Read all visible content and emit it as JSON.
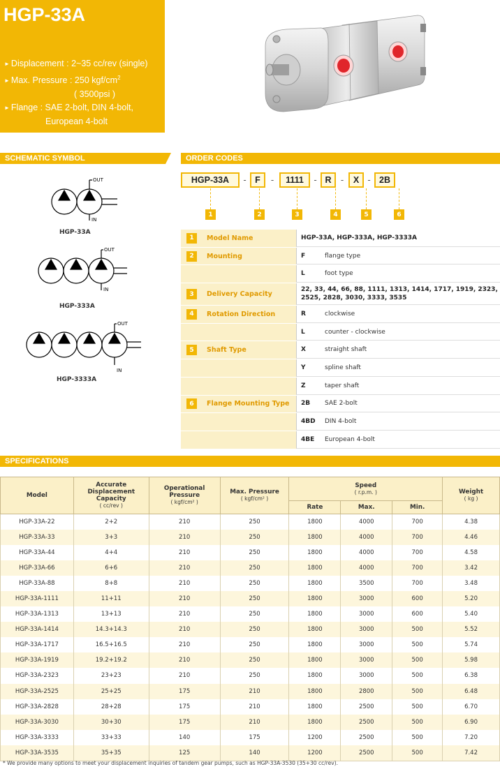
{
  "header": {
    "title": "HGP-33A",
    "features": [
      {
        "text": "Displacement : 2~35 cc/rev (single)"
      },
      {
        "text": "Max. Pressure : 250 kgf/cm",
        "sup": "2",
        "cont": "( 3500psi )"
      },
      {
        "text": "Flange : SAE 2-bolt, DIN 4-bolt,",
        "cont": "European 4-bolt"
      }
    ]
  },
  "schematic": {
    "title": "SCHEMATIC SYMBOL",
    "out_label": "OUT",
    "in_label": "IN",
    "symbols": [
      {
        "label": "HGP-33A"
      },
      {
        "label": "HGP-333A"
      },
      {
        "label": "HGP-3333A"
      }
    ]
  },
  "order_codes": {
    "title": "ORDER CODES",
    "codes": [
      "HGP-33A",
      "F",
      "1111",
      "R",
      "X",
      "2B"
    ],
    "dash": "-",
    "numbers": [
      "1",
      "2",
      "3",
      "4",
      "5",
      "6"
    ],
    "rows": [
      {
        "num": "1",
        "name": "Model Name",
        "full": "HGP-33A, HGP-333A, HGP-3333A"
      },
      {
        "num": "2",
        "name": "Mounting",
        "code": "F",
        "desc": "flange type"
      },
      {
        "num": "",
        "name": "",
        "code": "L",
        "desc": "foot type"
      },
      {
        "num": "3",
        "name": "Delivery Capacity",
        "full": "22, 33, 44, 66, 88, 1111, 1313, 1414, 1717, 1919, 2323, 2525, 2828, 3030, 3333, 3535"
      },
      {
        "num": "4",
        "name": "Rotation Direction",
        "code": "R",
        "desc": "clockwise"
      },
      {
        "num": "",
        "name": "",
        "code": "L",
        "desc": "counter - clockwise"
      },
      {
        "num": "5",
        "name": "Shaft Type",
        "code": "X",
        "desc": "straight shaft"
      },
      {
        "num": "",
        "name": "",
        "code": "Y",
        "desc": "spline shaft"
      },
      {
        "num": "",
        "name": "",
        "code": "Z",
        "desc": "taper shaft"
      },
      {
        "num": "6",
        "name": "Flange Mounting Type",
        "code": "2B",
        "desc": "SAE 2-bolt"
      },
      {
        "num": "",
        "name": "",
        "code": "4BD",
        "desc": "DIN 4-bolt"
      },
      {
        "num": "",
        "name": "",
        "code": "4BE",
        "desc": "European 4-bolt"
      }
    ]
  },
  "specifications": {
    "title": "SPECIFICATIONS",
    "headers": {
      "model": "Model",
      "disp": "Accurate Displacement Capacity",
      "disp_unit": "( cc/rev )",
      "op": "Operational Pressure",
      "op_unit": "( kgf/cm² )",
      "max": "Max. Pressure",
      "max_unit": "( kgf/cm² )",
      "speed": "Speed",
      "speed_unit": "( r.p.m. )",
      "rate": "Rate",
      "smax": "Max.",
      "smin": "Min.",
      "weight": "Weight",
      "weight_unit": "( kg )"
    },
    "rows": [
      [
        "HGP-33A-22",
        "2+2",
        "210",
        "250",
        "1800",
        "4000",
        "700",
        "4.38"
      ],
      [
        "HGP-33A-33",
        "3+3",
        "210",
        "250",
        "1800",
        "4000",
        "700",
        "4.46"
      ],
      [
        "HGP-33A-44",
        "4+4",
        "210",
        "250",
        "1800",
        "4000",
        "700",
        "4.58"
      ],
      [
        "HGP-33A-66",
        "6+6",
        "210",
        "250",
        "1800",
        "4000",
        "700",
        "3.42"
      ],
      [
        "HGP-33A-88",
        "8+8",
        "210",
        "250",
        "1800",
        "3500",
        "700",
        "3.48"
      ],
      [
        "HGP-33A-1111",
        "11+11",
        "210",
        "250",
        "1800",
        "3000",
        "600",
        "5.20"
      ],
      [
        "HGP-33A-1313",
        "13+13",
        "210",
        "250",
        "1800",
        "3000",
        "600",
        "5.40"
      ],
      [
        "HGP-33A-1414",
        "14.3+14.3",
        "210",
        "250",
        "1800",
        "3000",
        "500",
        "5.52"
      ],
      [
        "HGP-33A-1717",
        "16.5+16.5",
        "210",
        "250",
        "1800",
        "3000",
        "500",
        "5.74"
      ],
      [
        "HGP-33A-1919",
        "19.2+19.2",
        "210",
        "250",
        "1800",
        "3000",
        "500",
        "5.98"
      ],
      [
        "HGP-33A-2323",
        "23+23",
        "210",
        "250",
        "1800",
        "3000",
        "500",
        "6.38"
      ],
      [
        "HGP-33A-2525",
        "25+25",
        "175",
        "210",
        "1800",
        "2800",
        "500",
        "6.48"
      ],
      [
        "HGP-33A-2828",
        "28+28",
        "175",
        "210",
        "1800",
        "2500",
        "500",
        "6.70"
      ],
      [
        "HGP-33A-3030",
        "30+30",
        "175",
        "210",
        "1800",
        "2500",
        "500",
        "6.90"
      ],
      [
        "HGP-33A-3333",
        "33+33",
        "140",
        "175",
        "1200",
        "2500",
        "500",
        "7.20"
      ],
      [
        "HGP-33A-3535",
        "35+35",
        "125",
        "140",
        "1200",
        "2500",
        "500",
        "7.42"
      ]
    ],
    "footnote": "* We provide many options to meet your displacement inquiries of tandem gear pumps, such as HGP-33A-3530 (35+30 cc/rev)."
  },
  "colors": {
    "accent": "#f2b705",
    "light": "#fbf0c8",
    "port": "#e0262b"
  }
}
